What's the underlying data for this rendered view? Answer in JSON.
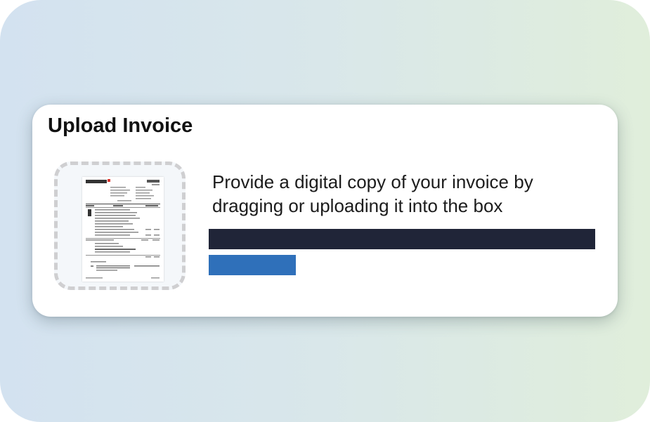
{
  "card": {
    "title": "Upload Invoice",
    "instructions": "Provide a digital copy of your invoice by dragging or uploading it into the box"
  },
  "dropzone": {
    "preview_icon": "invoice-document-thumbnail"
  },
  "progress_bar": {
    "fraction": 1.0
  },
  "upload_button": {
    "label": ""
  },
  "colors": {
    "progress_bar": "#202538",
    "upload_button": "#2f70ba",
    "dropzone_border": "#cfcfd1",
    "background_gradient_start": "#d3e2f0",
    "background_gradient_end": "#e0eedb"
  }
}
